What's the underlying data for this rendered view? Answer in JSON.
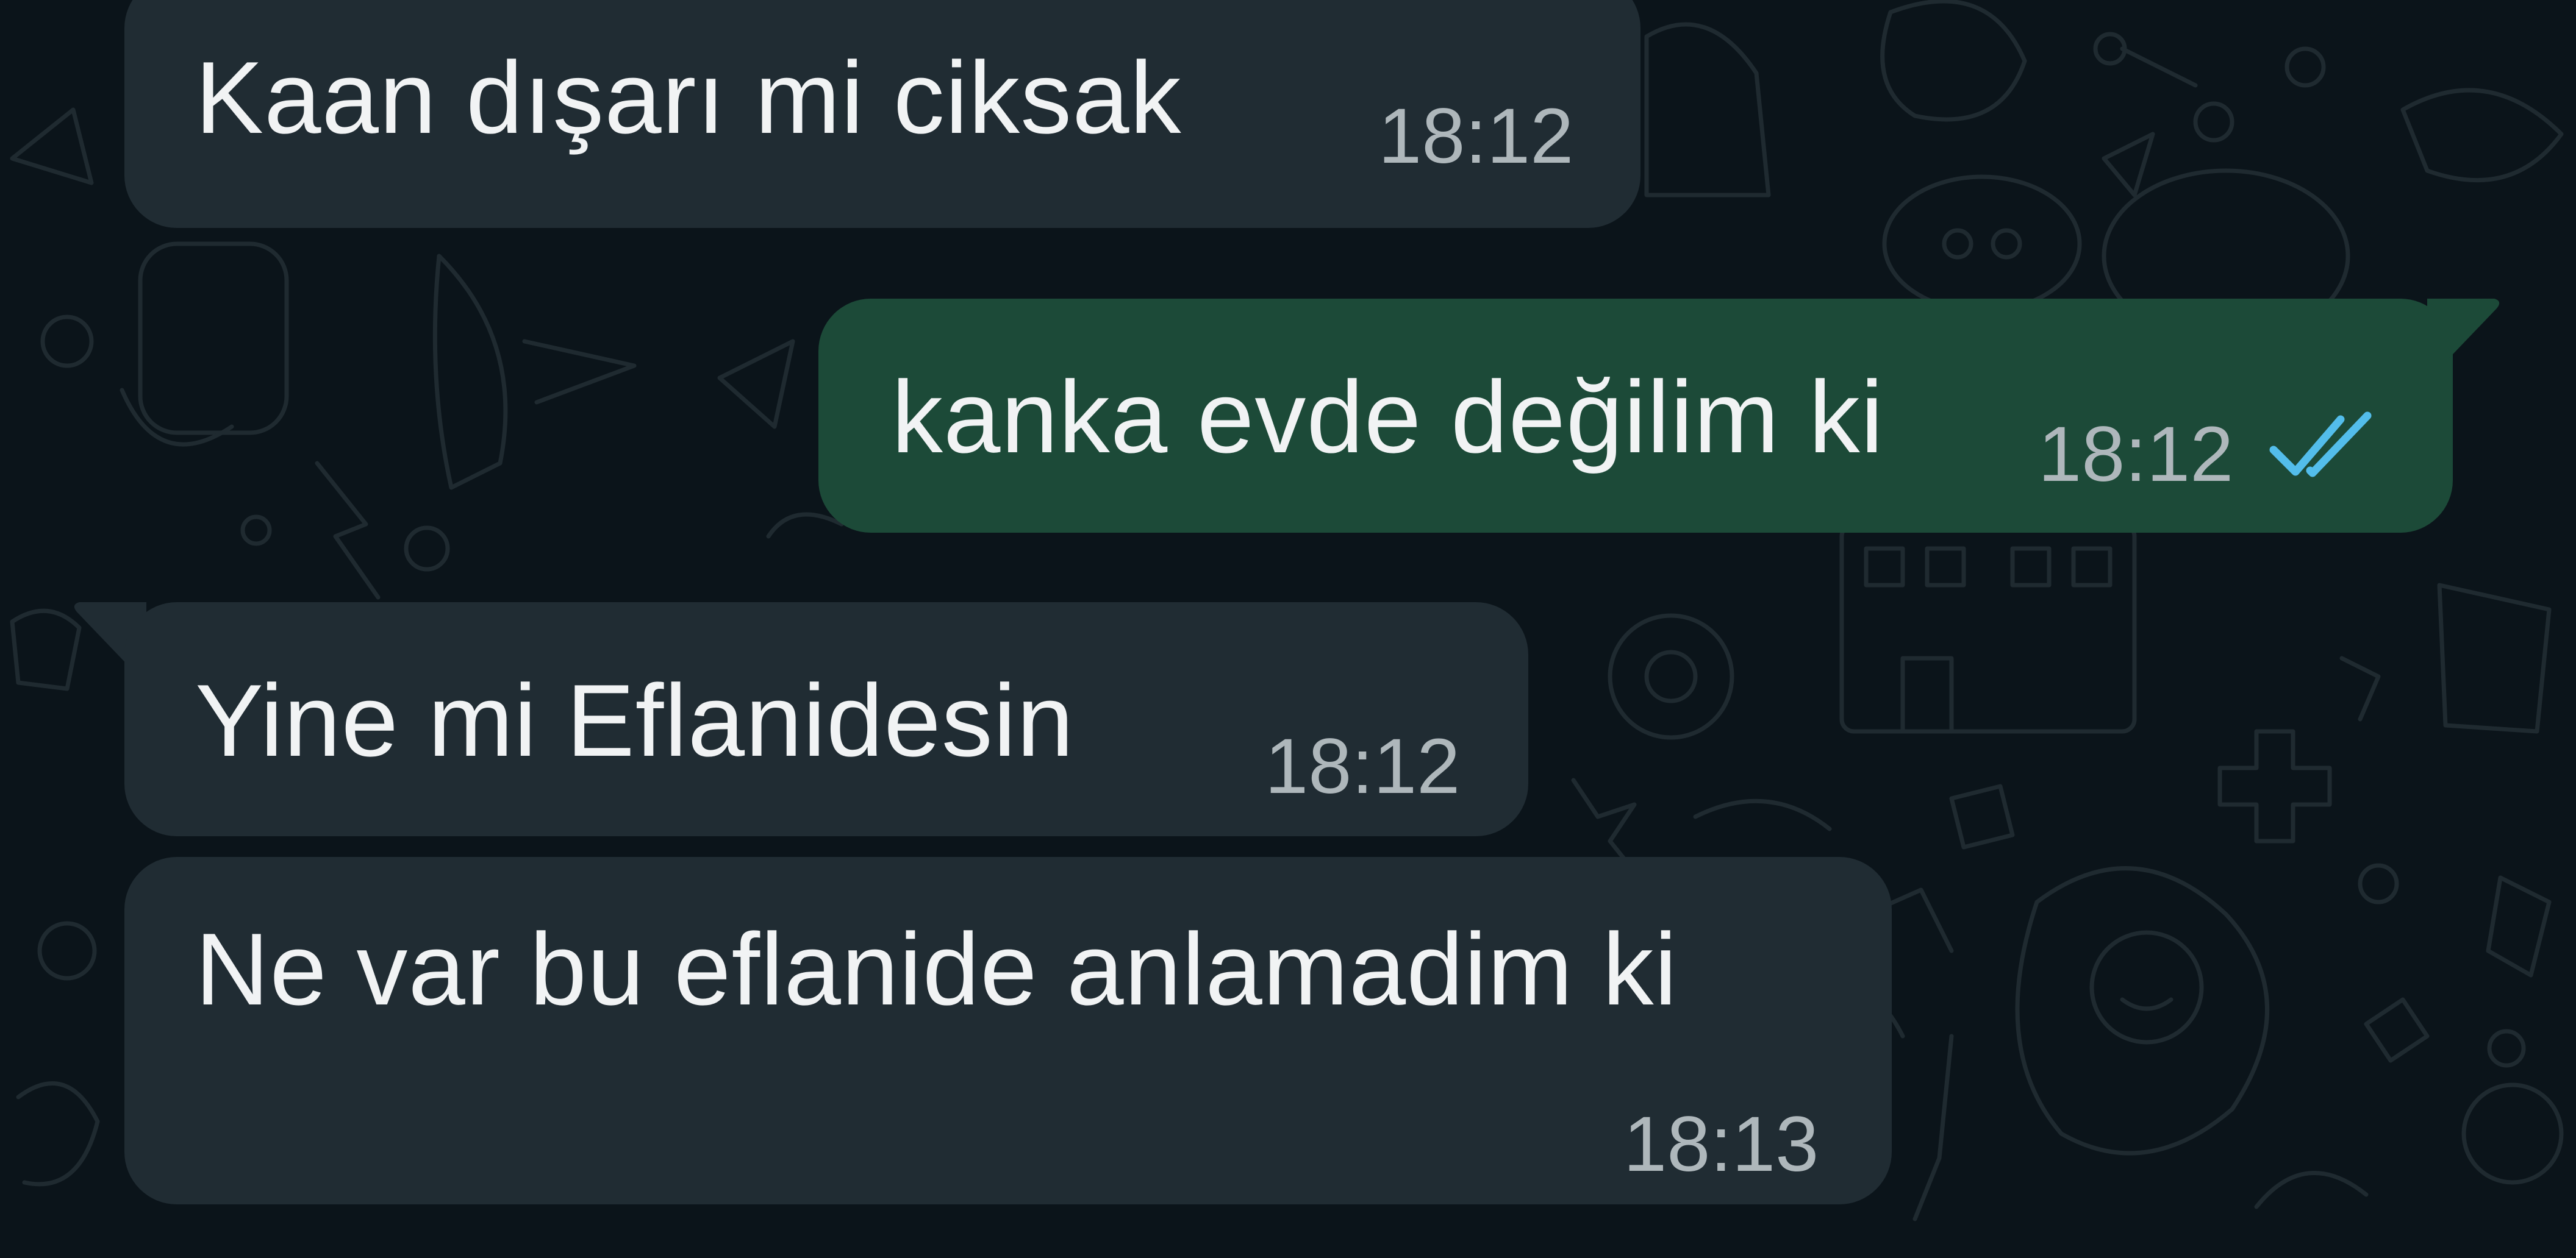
{
  "chat": {
    "messages": [
      {
        "direction": "incoming",
        "text": "Kaan dışarı mi ciksak",
        "time": "18:12"
      },
      {
        "direction": "outgoing",
        "text": "kanka evde değilim ki",
        "time": "18:12",
        "status": "read",
        "status_icon": "double-check-icon"
      },
      {
        "direction": "incoming",
        "text": "Yine mi Eflanidesin",
        "time": "18:12"
      },
      {
        "direction": "incoming",
        "text": "Ne var bu eflanide anlamadim ki",
        "time": "18:13"
      }
    ]
  },
  "colors": {
    "background": "#0b141a",
    "incoming_bubble": "#202c33",
    "outgoing_bubble": "#1c4a38",
    "message_text": "#f1f3f4",
    "timestamp": "#aeb7bb",
    "read_ticks": "#53bdeb",
    "wallpaper_doodles": "#1f2a30"
  }
}
